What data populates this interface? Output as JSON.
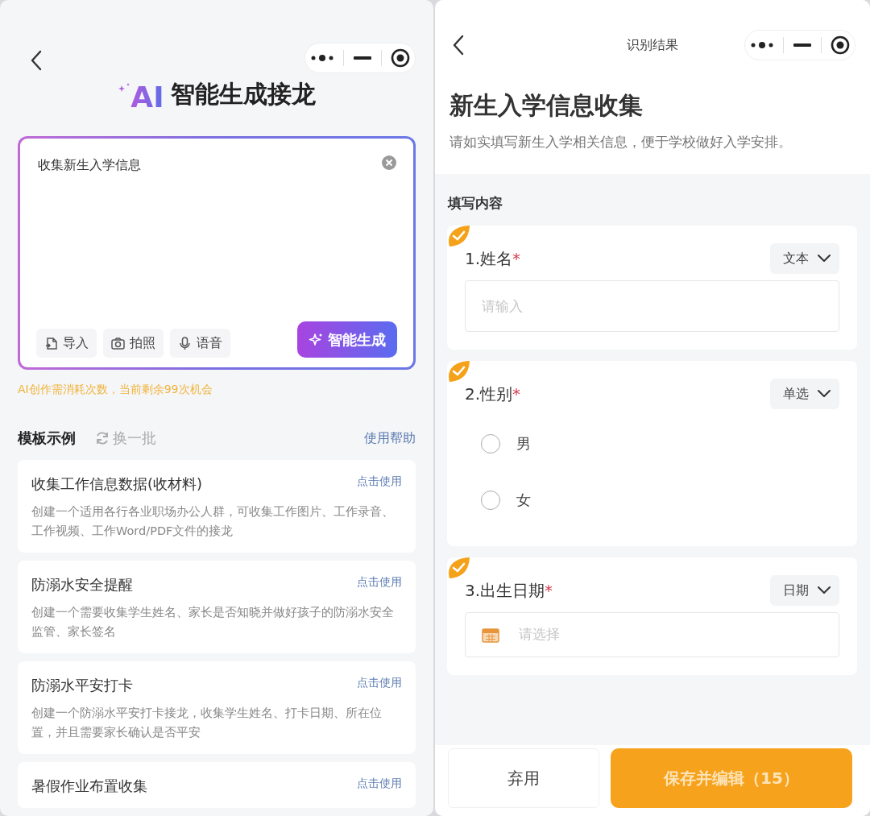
{
  "left_screen": {
    "logo_text": "AI",
    "title": "智能生成接龙",
    "prompt_input": {
      "value": "收集新生入学信息"
    },
    "input_tools": [
      {
        "label": "导入",
        "kind": "import"
      },
      {
        "label": "拍照",
        "kind": "camera"
      },
      {
        "label": "语音",
        "kind": "voice"
      }
    ],
    "generate_button": "智能生成",
    "quota_hint": "AI创作需消耗次数，当前剩余99次机会",
    "templates_header": {
      "title": "模板示例",
      "refresh": "换一批",
      "help": "使用帮助"
    },
    "templates": [
      {
        "title": "收集工作信息数据(收材料)",
        "action": "点击使用",
        "description": "创建一个适用各行各业职场办公人群，可收集工作图片、工作录音、工作视频、工作Word/PDF文件的接龙"
      },
      {
        "title": "防溺水安全提醒",
        "action": "点击使用",
        "description": "创建一个需要收集学生姓名、家长是否知晓并做好孩子的防溺水安全监管、家长签名"
      },
      {
        "title": "防溺水平安打卡",
        "action": "点击使用",
        "description": "创建一个防溺水平安打卡接龙，收集学生姓名、打卡日期、所在位置，并且需要家长确认是否平安"
      },
      {
        "title": "暑假作业布置收集",
        "action": "点击使用"
      }
    ]
  },
  "right_screen": {
    "nav_title": "识别结果",
    "form_title": "新生入学信息收集",
    "form_description": "请如实填写新生入学相关信息，便于学校做好入学安排。",
    "section_title": "填写内容",
    "fields": [
      {
        "kind": "text",
        "label": "1.姓名",
        "required_mark": "*",
        "type_select": "文本",
        "placeholder": "请输入"
      },
      {
        "kind": "radio",
        "label": "2.性别",
        "required_mark": "*",
        "type_select": "单选",
        "options": [
          {
            "label": "男",
            "selected": false
          },
          {
            "label": "女",
            "selected": false
          }
        ]
      },
      {
        "kind": "date",
        "label": "3.出生日期",
        "required_mark": "*",
        "type_select": "日期",
        "placeholder": "请选择"
      }
    ],
    "buttons": {
      "discard": "弃用",
      "save": "保存并编辑（15）"
    }
  }
}
